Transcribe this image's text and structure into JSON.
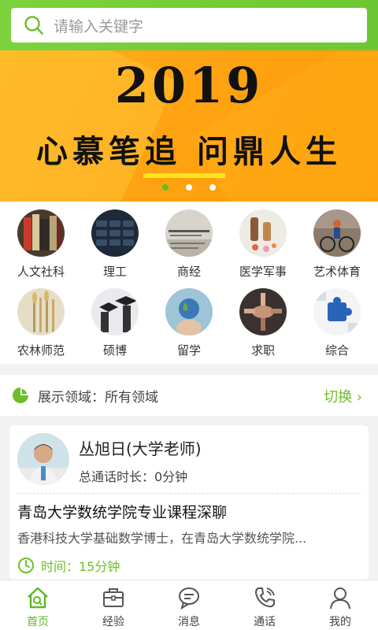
{
  "search": {
    "placeholder": "请输入关键字"
  },
  "banner": {
    "year": "2019",
    "slogan": "心慕笔追 问鼎人生",
    "slides": 3,
    "active_slide": 1
  },
  "categories": [
    {
      "label": "人文社科",
      "icon": "books-image"
    },
    {
      "label": "理工",
      "icon": "formula-image"
    },
    {
      "label": "商经",
      "icon": "business-image"
    },
    {
      "label": "医学军事",
      "icon": "medicine-image"
    },
    {
      "label": "艺术体育",
      "icon": "cycling-image"
    },
    {
      "label": "农林师范",
      "icon": "wheat-image"
    },
    {
      "label": "硕博",
      "icon": "graduation-image"
    },
    {
      "label": "留学",
      "icon": "globe-image"
    },
    {
      "label": "求职",
      "icon": "teamwork-image"
    },
    {
      "label": "综合",
      "icon": "puzzle-image"
    }
  ],
  "domain": {
    "text": "展示领域：所有领域",
    "switch_label": "切换 ›"
  },
  "card": {
    "name": "丛旭日(大学老师)",
    "call_time": "总通话时长：0分钟",
    "title": "青岛大学数统学院专业课程深聊",
    "description": "香港科技大学基础数学博士，在青岛大学数统学院...",
    "duration": "时间：15分钟"
  },
  "tabs": [
    {
      "label": "首页",
      "icon": "home-search-icon",
      "active": true
    },
    {
      "label": "经验",
      "icon": "briefcase-icon"
    },
    {
      "label": "消息",
      "icon": "chat-bubble-icon"
    },
    {
      "label": "通话",
      "icon": "phone-icon"
    },
    {
      "label": "我的",
      "icon": "user-icon"
    }
  ],
  "colors": {
    "accent": "#6cbf2a",
    "banner": "#ffa312",
    "active_dot": "#5cc020"
  }
}
